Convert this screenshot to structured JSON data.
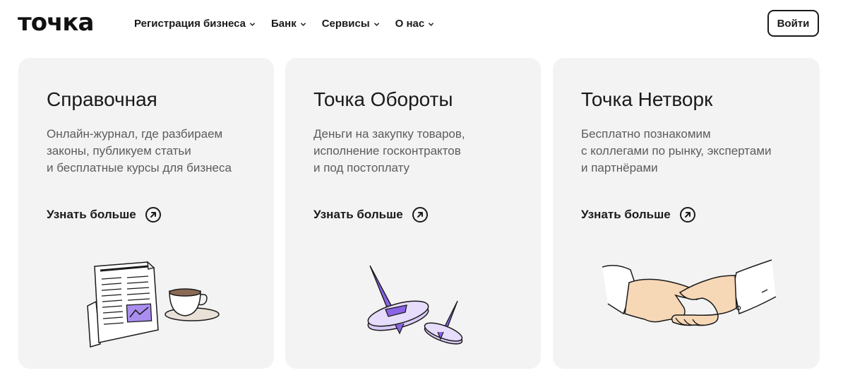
{
  "header": {
    "logo": "точка",
    "nav": [
      {
        "label": "Регистрация бизнеса"
      },
      {
        "label": "Банк"
      },
      {
        "label": "Сервисы"
      },
      {
        "label": "О нас"
      }
    ],
    "login_label": "Войти"
  },
  "cards": [
    {
      "title": "Справочная",
      "desc_lines": [
        "Онлайн-журнал, где разбираем",
        "законы, публикуем статьи",
        "и бесплатные курсы для бизнеса"
      ],
      "more_label": "Узнать больше"
    },
    {
      "title": "Точка Обороты",
      "desc_lines": [
        "Деньги на закупку товаров,",
        "исполнение госконтрактов",
        "и под постоплату"
      ],
      "more_label": "Узнать больше"
    },
    {
      "title": "Точка Нетворк",
      "desc_lines": [
        "Бесплатно познакомим",
        "с коллегами по рынку, экспертами",
        "и партнёрами"
      ],
      "more_label": "Узнать больше"
    }
  ],
  "colors": {
    "card_bg": "#f3f3f3",
    "accent_purple": "#8a63e6",
    "skin": "#f6d7b6",
    "text_muted": "#5c5c5c"
  }
}
